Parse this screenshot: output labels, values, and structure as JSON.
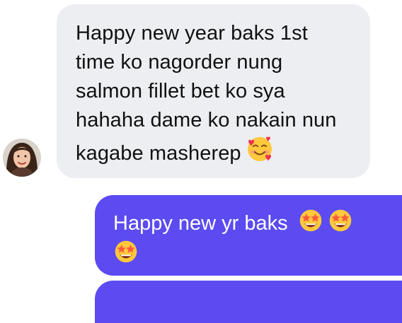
{
  "conversation": {
    "incoming_message": {
      "text": "Happy new year baks 1st time ko nagorder nung salmon fillet bet ko sya hahaha dame ko nakain nun kagabe masherep",
      "emoji": "smiling-face-with-hearts-icon"
    },
    "outgoing_message": {
      "text": "Happy new yr baks",
      "emojis": [
        "star-struck-icon",
        "star-struck-icon",
        "star-struck-icon"
      ]
    }
  },
  "colors": {
    "incoming_bubble": "#eceef1",
    "outgoing_bubble": "#5b4bf0",
    "incoming_text": "#111111",
    "outgoing_text": "#ffffff"
  }
}
